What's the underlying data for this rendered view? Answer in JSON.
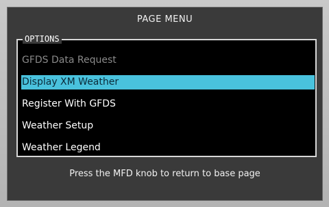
{
  "menu": {
    "title": "PAGE MENU",
    "options_label": "OPTIONS",
    "items": [
      {
        "label": "GFDS Data Request",
        "state": "disabled"
      },
      {
        "label": "Display XM Weather",
        "state": "selected"
      },
      {
        "label": "Register With GFDS",
        "state": "enabled"
      },
      {
        "label": "Weather Setup",
        "state": "enabled"
      },
      {
        "label": "Weather Legend",
        "state": "enabled"
      }
    ],
    "instruction": "Press the MFD knob to return to base page"
  },
  "colors": {
    "selection_highlight": "#49c2dd",
    "disabled_text": "#8a8a8a",
    "window_background": "#3a3a3a",
    "list_background": "#000000"
  }
}
